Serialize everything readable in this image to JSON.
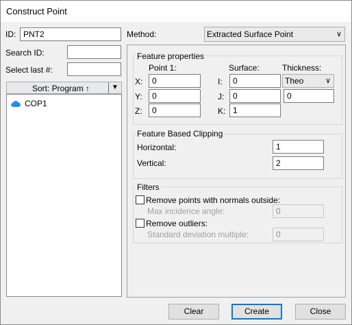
{
  "window": {
    "title": "Construct Point"
  },
  "left": {
    "id_label": "ID:",
    "id_value": "PNT2",
    "search_label": "Search ID:",
    "search_value": "",
    "select_last_label": "Select last #:",
    "select_last_value": "",
    "sort_label": "Sort: Program ↑",
    "sort_menu_glyph": "▼",
    "tree_items": [
      {
        "label": "COP1",
        "icon": "cloud-icon"
      }
    ]
  },
  "method": {
    "label": "Method:",
    "value": "Extracted Surface Point",
    "arrow": "∨"
  },
  "feature_properties": {
    "title": "Feature properties",
    "point_header": "Point 1:",
    "surface_header": "Surface:",
    "thickness_header": "Thickness:",
    "x_label": "X:",
    "x_value": "0",
    "y_label": "Y:",
    "y_value": "0",
    "z_label": "Z:",
    "z_value": "0",
    "i_label": "I:",
    "i_value": "0",
    "j_label": "J:",
    "j_value": "0",
    "k_label": "K:",
    "k_value": "1",
    "thickness_mode": "Theo",
    "thickness_arrow": "∨",
    "thickness_value": "0"
  },
  "clipping": {
    "title": "Feature Based Clipping",
    "horizontal_label": "Horizontal:",
    "horizontal_value": "1",
    "vertical_label": "Vertical:",
    "vertical_value": "2"
  },
  "filters": {
    "title": "Filters",
    "remove_normals_label": "Remove points with normals outside:",
    "remove_normals_checked": false,
    "max_angle_label": "Max incidence angle:",
    "max_angle_value": "0",
    "remove_outliers_label": "Remove outliers:",
    "remove_outliers_checked": false,
    "std_dev_label": "Standard deviation multiple:",
    "std_dev_value": "0"
  },
  "buttons": {
    "clear": "Clear",
    "create": "Create",
    "close": "Close"
  },
  "colors": {
    "accent": "#0078d7",
    "cloud_icon": "#1e90e6"
  }
}
